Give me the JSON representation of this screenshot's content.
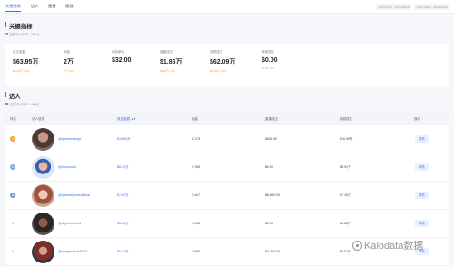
{
  "nav": {
    "tabs": [
      {
        "label": "关键指标",
        "active": true
      },
      {
        "label": "达人",
        "active": false
      },
      {
        "label": "直播",
        "active": false
      },
      {
        "label": "视频",
        "active": false
      }
    ],
    "date_start": "08/07/2023 ~ 08/13/2023",
    "date_end": "08/07/2023 ~ 08/13/2023"
  },
  "key_metrics": {
    "title": "关键指标",
    "subtitle": "过去7天 (08/07 - 08/13)",
    "items": [
      {
        "label": "成交金额",
        "value": "$63.95万",
        "sub": "$63.95万 0.0%"
      },
      {
        "label": "销量",
        "value": "2万",
        "sub": "2万 0.0%"
      },
      {
        "label": "商品单价",
        "value": "$32.00",
        "sub": ""
      },
      {
        "label": "直播成交",
        "value": "$1.86万",
        "sub": "$1.86万 0.0%"
      },
      {
        "label": "视频成交",
        "value": "$62.09万",
        "sub": "$62.09万 0.0%"
      },
      {
        "label": "商城成交",
        "value": "$0.00",
        "sub": "$0.00 0.0%"
      }
    ]
  },
  "creators": {
    "title": "达人",
    "subtitle": "过去7天 (08/07 - 08/13)",
    "columns": {
      "rank": "排名",
      "info": "达人信息",
      "gmv": "成交金额",
      "sales": "销量",
      "live_gmv": "直播成交",
      "video_gmv": "视频成交",
      "action": "操作"
    },
    "rows": [
      {
        "rank": "1",
        "handle": "@queenicangx",
        "gmv": "$10.55万",
        "sales": "3,173",
        "live_gmv": "$544.00",
        "video_gmv": "$10.50万",
        "action": "详情"
      },
      {
        "rank": "2",
        "handle": "@bizemunk",
        "gmv": "$8.91万",
        "sales": "2,785",
        "live_gmv": "$0.00",
        "video_gmv": "$8.91万",
        "action": "详情"
      },
      {
        "rank": "3",
        "handle": "@joannelynneofficial",
        "gmv": "$7.82万",
        "sales": "2,447",
        "live_gmv": "$6,689.00",
        "video_gmv": "$7.16万",
        "action": "详情"
      },
      {
        "rank": "4",
        "handle": "@diyaricocc44",
        "gmv": "$6.83万",
        "sales": "2,135",
        "live_gmv": "$0.00",
        "video_gmv": "$6.83万",
        "action": "详情"
      },
      {
        "rank": "5",
        "handle": "@amyjackson9213",
        "gmv": "$5.33万",
        "sales": "1,665",
        "live_gmv": "$3,104.00",
        "video_gmv": "$5.02万",
        "action": "详情"
      }
    ]
  },
  "watermark": "Kalodata数据",
  "colors": {
    "accent": "#3f6ee8",
    "gold": "#f2a23b",
    "silver": "#8aa3d8",
    "bronze": "#7f9ad6"
  }
}
